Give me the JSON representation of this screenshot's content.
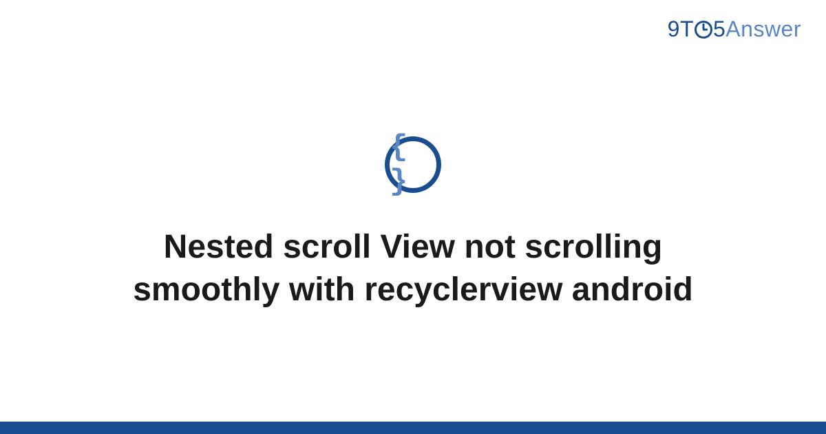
{
  "logo": {
    "part1": "9T",
    "part2": "5",
    "part3": "Answer"
  },
  "icon": {
    "glyph": "{ }",
    "name": "code-braces-icon"
  },
  "title": "Nested scroll View not scrolling smoothly with recyclerview android",
  "colors": {
    "primary": "#1a4d8f",
    "secondary": "#5a87c4",
    "text": "#1a1a1a",
    "background": "#ffffff"
  }
}
